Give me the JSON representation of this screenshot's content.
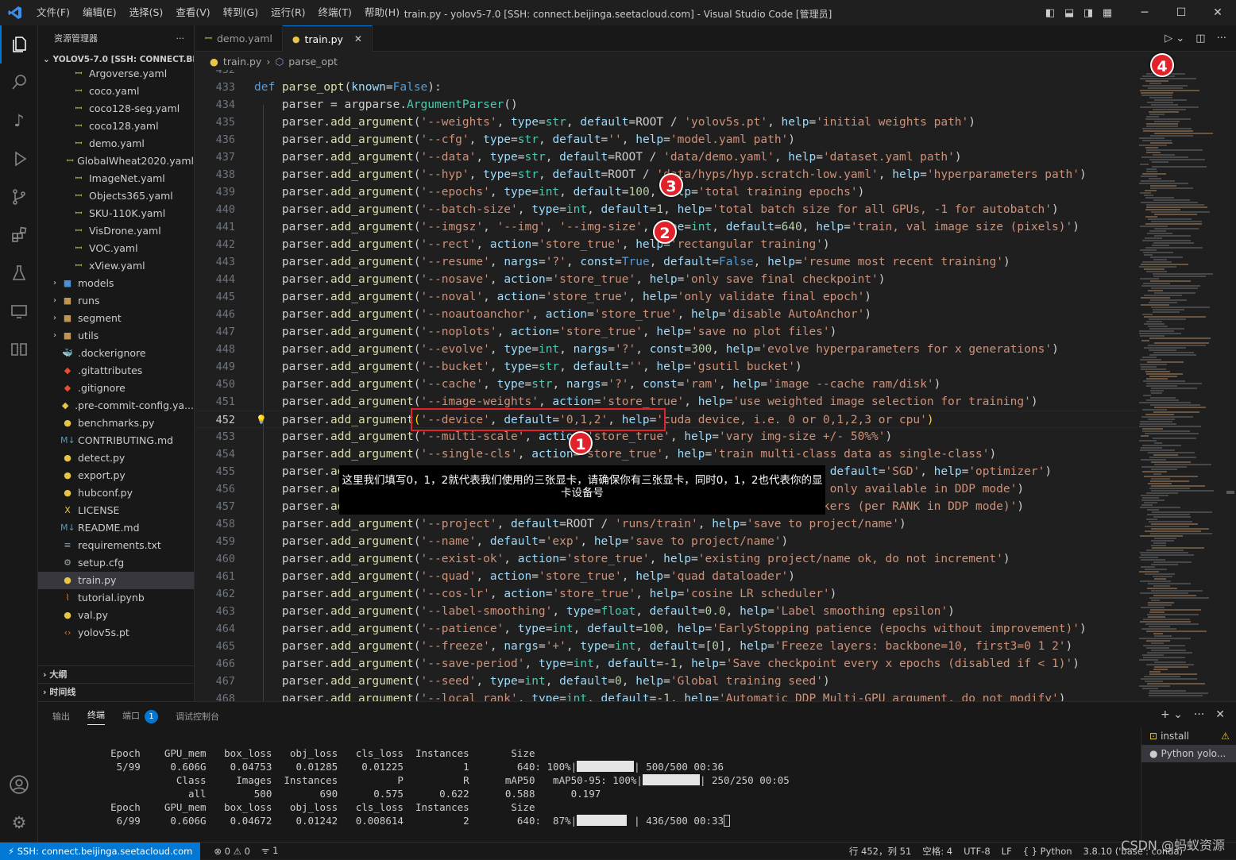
{
  "titlebar": {
    "menu": [
      "文件(F)",
      "编辑(E)",
      "选择(S)",
      "查看(V)",
      "转到(G)",
      "运行(R)",
      "终端(T)",
      "帮助(H)"
    ],
    "title": "train.py - yolov5-7.0 [SSH: connect.beijinga.seetacloud.com] - Visual Studio Code [管理员]"
  },
  "sidebar": {
    "header": "资源管理器",
    "root": "YOLOV5-7.0 [SSH: CONNECT.BEI...",
    "items": [
      {
        "label": "Argoverse.yaml",
        "indent": 2,
        "icon": "yaml"
      },
      {
        "label": "coco.yaml",
        "indent": 2,
        "icon": "yaml"
      },
      {
        "label": "coco128-seg.yaml",
        "indent": 2,
        "icon": "yaml"
      },
      {
        "label": "coco128.yaml",
        "indent": 2,
        "icon": "yaml"
      },
      {
        "label": "demo.yaml",
        "indent": 2,
        "icon": "yaml"
      },
      {
        "label": "GlobalWheat2020.yaml",
        "indent": 2,
        "icon": "yaml"
      },
      {
        "label": "ImageNet.yaml",
        "indent": 2,
        "icon": "yaml"
      },
      {
        "label": "Objects365.yaml",
        "indent": 2,
        "icon": "yaml"
      },
      {
        "label": "SKU-110K.yaml",
        "indent": 2,
        "icon": "yaml"
      },
      {
        "label": "VisDrone.yaml",
        "indent": 2,
        "icon": "yaml"
      },
      {
        "label": "VOC.yaml",
        "indent": 2,
        "icon": "yaml"
      },
      {
        "label": "xView.yaml",
        "indent": 2,
        "icon": "yaml"
      },
      {
        "label": "models",
        "indent": 1,
        "icon": "folder-blue",
        "folder": true
      },
      {
        "label": "runs",
        "indent": 1,
        "icon": "folder",
        "folder": true
      },
      {
        "label": "segment",
        "indent": 1,
        "icon": "folder",
        "folder": true
      },
      {
        "label": "utils",
        "indent": 1,
        "icon": "folder",
        "folder": true
      },
      {
        "label": ".dockerignore",
        "indent": 1,
        "icon": "docker"
      },
      {
        "label": ".gitattributes",
        "indent": 1,
        "icon": "git"
      },
      {
        "label": ".gitignore",
        "indent": 1,
        "icon": "git"
      },
      {
        "label": ".pre-commit-config.ya...",
        "indent": 1,
        "icon": "precommit"
      },
      {
        "label": "benchmarks.py",
        "indent": 1,
        "icon": "python"
      },
      {
        "label": "CONTRIBUTING.md",
        "indent": 1,
        "icon": "md"
      },
      {
        "label": "detect.py",
        "indent": 1,
        "icon": "python"
      },
      {
        "label": "export.py",
        "indent": 1,
        "icon": "python"
      },
      {
        "label": "hubconf.py",
        "indent": 1,
        "icon": "python"
      },
      {
        "label": "LICENSE",
        "indent": 1,
        "icon": "license"
      },
      {
        "label": "README.md",
        "indent": 1,
        "icon": "md"
      },
      {
        "label": "requirements.txt",
        "indent": 1,
        "icon": "txt"
      },
      {
        "label": "setup.cfg",
        "indent": 1,
        "icon": "gear"
      },
      {
        "label": "train.py",
        "indent": 1,
        "icon": "python",
        "selected": true
      },
      {
        "label": "tutorial.ipynb",
        "indent": 1,
        "icon": "notebook"
      },
      {
        "label": "val.py",
        "indent": 1,
        "icon": "python"
      },
      {
        "label": "yolov5s.pt",
        "indent": 1,
        "icon": "code"
      }
    ],
    "outline": "大纲",
    "timeline": "时间线"
  },
  "tabs": [
    {
      "label": "demo.yaml",
      "icon": "yaml",
      "active": false
    },
    {
      "label": "train.py",
      "icon": "python",
      "active": true
    }
  ],
  "breadcrumb": {
    "file": "train.py",
    "symbol": "parse_opt"
  },
  "editor": {
    "current_line": 452,
    "lines": [
      {
        "n": "432",
        "c": ""
      },
      {
        "n": "433",
        "c": "<span class=\"kw\">def</span> <span class=\"fn\">parse_opt</span>(<span class=\"pa\">known</span>=<span class=\"co\">False</span>):"
      },
      {
        "n": "434",
        "c": "    parser = argparse.<span class=\"bi\">ArgumentParser</span>()"
      },
      {
        "n": "435",
        "c": "    parser.<span class=\"fn\">add_argument</span>(<span class=\"st\">'--weights'</span>, <span class=\"pa\">type</span>=<span class=\"bi\">str</span>, <span class=\"pa\">default</span>=ROOT / <span class=\"st\">'yolov5s.pt'</span>, <span class=\"pa\">help</span>=<span class=\"st\">'initial weights path'</span>)"
      },
      {
        "n": "436",
        "c": "    parser.<span class=\"fn\">add_argument</span>(<span class=\"st\">'--cfg'</span>, <span class=\"pa\">type</span>=<span class=\"bi\">str</span>, <span class=\"pa\">default</span>=<span class=\"st\">''</span>, <span class=\"pa\">help</span>=<span class=\"st\">'model.yaml path'</span>)"
      },
      {
        "n": "437",
        "c": "    parser.<span class=\"fn\">add_argument</span>(<span class=\"st\">'--data'</span>, <span class=\"pa\">type</span>=<span class=\"bi\">str</span>, <span class=\"pa\">default</span>=ROOT / <span class=\"st\">'data/demo.yaml'</span>, <span class=\"pa\">help</span>=<span class=\"st\">'dataset.yaml path'</span>)"
      },
      {
        "n": "438",
        "c": "    parser.<span class=\"fn\">add_argument</span>(<span class=\"st\">'--hyp'</span>, <span class=\"pa\">type</span>=<span class=\"bi\">str</span>, <span class=\"pa\">default</span>=ROOT / <span class=\"st\">'data/hyps/hyp.scratch-low.yaml'</span>, <span class=\"pa\">help</span>=<span class=\"st\">'hyperparameters path'</span>)"
      },
      {
        "n": "439",
        "c": "    parser.<span class=\"fn\">add_argument</span>(<span class=\"st\">'--epochs'</span>, <span class=\"pa\">type</span>=<span class=\"bi\">int</span>, <span class=\"pa\">default</span>=<span class=\"nu\">100</span>, <span class=\"pa\">help</span>=<span class=\"st\">'total training epochs'</span>)"
      },
      {
        "n": "440",
        "c": "    parser.<span class=\"fn\">add_argument</span>(<span class=\"st\">'--batch-size'</span>, <span class=\"pa\">type</span>=<span class=\"bi\">int</span>, <span class=\"pa\">default</span>=<span class=\"nu\">1</span>, <span class=\"pa\">help</span>=<span class=\"st\">'total batch size for all GPUs, -1 for autobatch'</span>)"
      },
      {
        "n": "441",
        "c": "    parser.<span class=\"fn\">add_argument</span>(<span class=\"st\">'--imgsz'</span>, <span class=\"st\">'--img'</span>, <span class=\"st\">'--img-size'</span>, <span class=\"pa\">type</span>=<span class=\"bi\">int</span>, <span class=\"pa\">default</span>=<span class=\"nu\">640</span>, <span class=\"pa\">help</span>=<span class=\"st\">'train, val image size (pixels)'</span>)"
      },
      {
        "n": "442",
        "c": "    parser.<span class=\"fn\">add_argument</span>(<span class=\"st\">'--rect'</span>, <span class=\"pa\">action</span>=<span class=\"st\">'store_true'</span>, <span class=\"pa\">help</span>=<span class=\"st\">'rectangular training'</span>)"
      },
      {
        "n": "443",
        "c": "    parser.<span class=\"fn\">add_argument</span>(<span class=\"st\">'--resume'</span>, <span class=\"pa\">nargs</span>=<span class=\"st\">'?'</span>, <span class=\"pa\">const</span>=<span class=\"co\">True</span>, <span class=\"pa\">default</span>=<span class=\"co\">False</span>, <span class=\"pa\">help</span>=<span class=\"st\">'resume most recent training'</span>)"
      },
      {
        "n": "444",
        "c": "    parser.<span class=\"fn\">add_argument</span>(<span class=\"st\">'--nosave'</span>, <span class=\"pa\">action</span>=<span class=\"st\">'store_true'</span>, <span class=\"pa\">help</span>=<span class=\"st\">'only save final checkpoint'</span>)"
      },
      {
        "n": "445",
        "c": "    parser.<span class=\"fn\">add_argument</span>(<span class=\"st\">'--noval'</span>, <span class=\"pa\">action</span>=<span class=\"st\">'store_true'</span>, <span class=\"pa\">help</span>=<span class=\"st\">'only validate final epoch'</span>)"
      },
      {
        "n": "446",
        "c": "    parser.<span class=\"fn\">add_argument</span>(<span class=\"st\">'--noautoanchor'</span>, <span class=\"pa\">action</span>=<span class=\"st\">'store_true'</span>, <span class=\"pa\">help</span>=<span class=\"st\">'disable AutoAnchor'</span>)"
      },
      {
        "n": "447",
        "c": "    parser.<span class=\"fn\">add_argument</span>(<span class=\"st\">'--noplots'</span>, <span class=\"pa\">action</span>=<span class=\"st\">'store_true'</span>, <span class=\"pa\">help</span>=<span class=\"st\">'save no plot files'</span>)"
      },
      {
        "n": "448",
        "c": "    parser.<span class=\"fn\">add_argument</span>(<span class=\"st\">'--evolve'</span>, <span class=\"pa\">type</span>=<span class=\"bi\">int</span>, <span class=\"pa\">nargs</span>=<span class=\"st\">'?'</span>, <span class=\"pa\">const</span>=<span class=\"nu\">300</span>, <span class=\"pa\">help</span>=<span class=\"st\">'evolve hyperparameters for x generations'</span>)"
      },
      {
        "n": "449",
        "c": "    parser.<span class=\"fn\">add_argument</span>(<span class=\"st\">'--bucket'</span>, <span class=\"pa\">type</span>=<span class=\"bi\">str</span>, <span class=\"pa\">default</span>=<span class=\"st\">''</span>, <span class=\"pa\">help</span>=<span class=\"st\">'gsutil bucket'</span>)"
      },
      {
        "n": "450",
        "c": "    parser.<span class=\"fn\">add_argument</span>(<span class=\"st\">'--cache'</span>, <span class=\"pa\">type</span>=<span class=\"bi\">str</span>, <span class=\"pa\">nargs</span>=<span class=\"st\">'?'</span>, <span class=\"pa\">const</span>=<span class=\"st\">'ram'</span>, <span class=\"pa\">help</span>=<span class=\"st\">'image --cache ram/disk'</span>)"
      },
      {
        "n": "451",
        "c": "    parser.<span class=\"fn\">add_argument</span>(<span class=\"st\">'--image-weights'</span>, <span class=\"pa\">action</span>=<span class=\"st\">'store_true'</span>, <span class=\"pa\">help</span>=<span class=\"st\">'use weighted image selection for training'</span>)"
      },
      {
        "n": "452",
        "c": "    parser.<span class=\"fn\">add_argument</span><span class=\"br\">(</span><span class=\"st\">'--device'</span>, <span class=\"pa\">default</span>=<span class=\"st\">'0,1,2'</span>, <span class=\"pa\">help</span>=<span class=\"st\">'cuda device, i.e. 0 or 0,1,2,3 or cpu'</span><span class=\"br\">)</span>"
      },
      {
        "n": "453",
        "c": "    parser.<span class=\"fn\">add_argument</span>(<span class=\"st\">'--multi-scale'</span>, <span class=\"pa\">action</span>=<span class=\"st\">'store_true'</span>, <span class=\"pa\">help</span>=<span class=\"st\">'vary img-size +/- 50%%'</span>)"
      },
      {
        "n": "454",
        "c": "    parser.<span class=\"fn\">add_argument</span>(<span class=\"st\">'--single-cls'</span>, <span class=\"pa\">action</span>=<span class=\"st\">'store_true'</span>, <span class=\"pa\">help</span>=<span class=\"st\">'train multi-class data as single-class'</span>)"
      },
      {
        "n": "455",
        "c": "    parser.<span class=\"fn\">add_argument</span>(<span class=\"st\">'--optimizer'</span>, <span class=\"pa\">type</span>=<span class=\"bi\">str</span>, <span class=\"pa\">choices</span>=[<span class=\"st\">'SGD'</span>, <span class=\"st\">'Adam'</span>, <span class=\"st\">'AdamW'</span>], <span class=\"pa\">default</span>=<span class=\"st\">'SGD'</span>, <span class=\"pa\">help</span>=<span class=\"st\">'optimizer'</span>)"
      },
      {
        "n": "456",
        "c": "    parser.<span class=\"fn\">add_argument</span>(<span class=\"st\">'--sync-bn'</span>, <span class=\"pa\">action</span>=<span class=\"st\">'store_true'</span>, <span class=\"pa\">help</span>=<span class=\"st\">'use SyncBatchNorm, only available in DDP mode'</span>)"
      },
      {
        "n": "457",
        "c": "    parser.<span class=\"fn\">add_argument</span>(<span class=\"st\">'--workers'</span>, <span class=\"pa\">type</span>=<span class=\"bi\">int</span>, <span class=\"pa\">default</span>=<span class=\"nu\">8</span>, <span class=\"pa\">help</span>=<span class=\"st\">'max dataloader workers (per RANK in DDP mode)'</span>)"
      },
      {
        "n": "458",
        "c": "    parser.<span class=\"fn\">add_argument</span>(<span class=\"st\">'--project'</span>, <span class=\"pa\">default</span>=ROOT / <span class=\"st\">'runs/train'</span>, <span class=\"pa\">help</span>=<span class=\"st\">'save to project/name'</span>)"
      },
      {
        "n": "459",
        "c": "    parser.<span class=\"fn\">add_argument</span>(<span class=\"st\">'--name'</span>, <span class=\"pa\">default</span>=<span class=\"st\">'exp'</span>, <span class=\"pa\">help</span>=<span class=\"st\">'save to project/name'</span>)"
      },
      {
        "n": "460",
        "c": "    parser.<span class=\"fn\">add_argument</span>(<span class=\"st\">'--exist-ok'</span>, <span class=\"pa\">action</span>=<span class=\"st\">'store_true'</span>, <span class=\"pa\">help</span>=<span class=\"st\">'existing project/name ok, do not increment'</span>)"
      },
      {
        "n": "461",
        "c": "    parser.<span class=\"fn\">add_argument</span>(<span class=\"st\">'--quad'</span>, <span class=\"pa\">action</span>=<span class=\"st\">'store_true'</span>, <span class=\"pa\">help</span>=<span class=\"st\">'quad dataloader'</span>)"
      },
      {
        "n": "462",
        "c": "    parser.<span class=\"fn\">add_argument</span>(<span class=\"st\">'--cos-lr'</span>, <span class=\"pa\">action</span>=<span class=\"st\">'store_true'</span>, <span class=\"pa\">help</span>=<span class=\"st\">'cosine LR scheduler'</span>)"
      },
      {
        "n": "463",
        "c": "    parser.<span class=\"fn\">add_argument</span>(<span class=\"st\">'--label-smoothing'</span>, <span class=\"pa\">type</span>=<span class=\"bi\">float</span>, <span class=\"pa\">default</span>=<span class=\"nu\">0.0</span>, <span class=\"pa\">help</span>=<span class=\"st\">'Label smoothing epsilon'</span>)"
      },
      {
        "n": "464",
        "c": "    parser.<span class=\"fn\">add_argument</span>(<span class=\"st\">'--patience'</span>, <span class=\"pa\">type</span>=<span class=\"bi\">int</span>, <span class=\"pa\">default</span>=<span class=\"nu\">100</span>, <span class=\"pa\">help</span>=<span class=\"st\">'EarlyStopping patience (epochs without improvement)'</span>)"
      },
      {
        "n": "465",
        "c": "    parser.<span class=\"fn\">add_argument</span>(<span class=\"st\">'--freeze'</span>, <span class=\"pa\">nargs</span>=<span class=\"st\">'+'</span>, <span class=\"pa\">type</span>=<span class=\"bi\">int</span>, <span class=\"pa\">default</span>=[<span class=\"nu\">0</span>], <span class=\"pa\">help</span>=<span class=\"st\">'Freeze layers: backbone=10, first3=0 1 2'</span>)"
      },
      {
        "n": "466",
        "c": "    parser.<span class=\"fn\">add_argument</span>(<span class=\"st\">'--save-period'</span>, <span class=\"pa\">type</span>=<span class=\"bi\">int</span>, <span class=\"pa\">default</span>=-<span class=\"nu\">1</span>, <span class=\"pa\">help</span>=<span class=\"st\">'Save checkpoint every x epochs (disabled if &lt; 1)'</span>)"
      },
      {
        "n": "467",
        "c": "    parser.<span class=\"fn\">add_argument</span>(<span class=\"st\">'--seed'</span>, <span class=\"pa\">type</span>=<span class=\"bi\">int</span>, <span class=\"pa\">default</span>=<span class=\"nu\">0</span>, <span class=\"pa\">help</span>=<span class=\"st\">'Global training seed'</span>)"
      },
      {
        "n": "468",
        "c": "    parser.<span class=\"fn\">add_argument</span>(<span class=\"st\">'--local_rank'</span>, <span class=\"pa\">type</span>=<span class=\"bi\">int</span>, <span class=\"pa\">default</span>=-<span class=\"nu\">1</span>, <span class=\"pa\">help</span>=<span class=\"st\">'Automatic DDP Multi-GPU argument, do not modify'</span>)"
      }
    ]
  },
  "annotations": {
    "markers": [
      "1",
      "2",
      "3",
      "4"
    ],
    "note": "这里我们填写0，1，2就代表我们使用的三张显卡，请确保你有三张显卡，同时0，1，2也代表你的显卡设备号"
  },
  "panel": {
    "tabs": [
      "输出",
      "终端",
      "端口",
      "调试控制台"
    ],
    "active_tab": "终端",
    "ports_badge": "1",
    "terminals": [
      {
        "label": "install",
        "icon": "warning"
      },
      {
        "label": "Python yolo...",
        "icon": "python",
        "selected": true
      }
    ],
    "terminal_lines": [
      "      Epoch    GPU_mem   box_loss   obj_loss   cls_loss  Instances       Size",
      "       5/99     0.606G    0.04753    0.01285    0.01225          1        640: 100%|{bar:1.0}| 500/500 00:36",
      "                 Class     Images  Instances          P          R      mAP50   mAP50-95: 100%|{bar:1.0}| 250/250 00:05",
      "                   all        500        690      0.575      0.622      0.588      0.197",
      "",
      "      Epoch    GPU_mem   box_loss   obj_loss   cls_loss  Instances       Size",
      "       6/99     0.606G    0.04672    0.01242   0.008614          2        640:  87%|{bar:0.87}| 436/500 00:33{cursor}"
    ]
  },
  "statusbar": {
    "remote": "SSH: connect.beijinga.seetacloud.com",
    "errors": "0",
    "warnings": "0",
    "ports": "1",
    "position": "行 452，列 51",
    "spaces": "空格: 4",
    "encoding": "UTF-8",
    "eol": "LF",
    "language": "Python",
    "interpreter": "3.8.10 ('base': conda)"
  },
  "watermark": "CSDN @蚂蚁资源",
  "colors": {
    "accent": "#0078d4",
    "annotation_red": "#e0232b",
    "background": "#1f1f1f"
  }
}
